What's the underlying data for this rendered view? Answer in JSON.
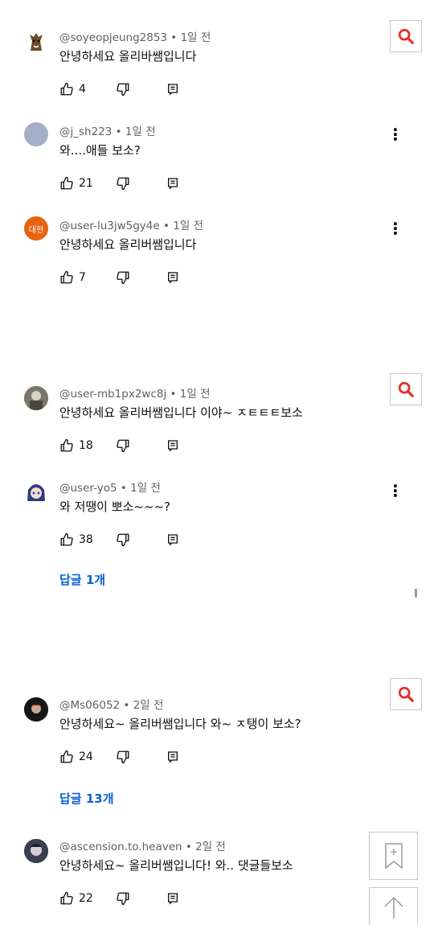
{
  "comments": [
    {
      "handle": "@soyeopjeung2853",
      "time": "1일 전",
      "text": "안녕하세요 올리바쌤입니다",
      "likes": "4",
      "avatar": "horse"
    },
    {
      "handle": "@j_sh223",
      "time": "1일 전",
      "text": "와....애들 보소?",
      "likes": "21",
      "avatar": "plain"
    },
    {
      "handle": "@user-lu3jw5gy4e",
      "time": "1일 전",
      "text": "안녕하세요 올리버쌤입니다",
      "likes": "7",
      "avatar": "initial",
      "avatar_text": "대현"
    },
    {
      "handle": "@user-mb1px2wc8j",
      "time": "1일 전",
      "text": "안녕하세요 올리버쌤입니다 이야~ ㅈㅌㅌㅌ보소",
      "likes": "18",
      "avatar": "photo"
    },
    {
      "handle": "@user-yo5",
      "time": "1일 전",
      "text": "와 저땡이 뽀소~~~?",
      "likes": "38",
      "avatar": "anime",
      "replies": "답글 1개"
    },
    {
      "handle": "@Ms06052",
      "time": "2일 전",
      "text": "안녕하세요~ 올리버쌤입니다 와~ ㅈ탱이 보소?",
      "likes": "24",
      "avatar": "dark",
      "replies": "답글 13개"
    },
    {
      "handle": "@ascension.to.heaven",
      "time": "2일 전",
      "text": "안녕하세요~ 올리버쌤입니다! 와.. 댓글들보소",
      "likes": "22",
      "avatar": "dark2"
    }
  ],
  "colors": {
    "accent": "#e52d27",
    "link": "#065fd4",
    "avatar_orange": "#e8620f",
    "avatar_gray": "#a3b0c8"
  }
}
